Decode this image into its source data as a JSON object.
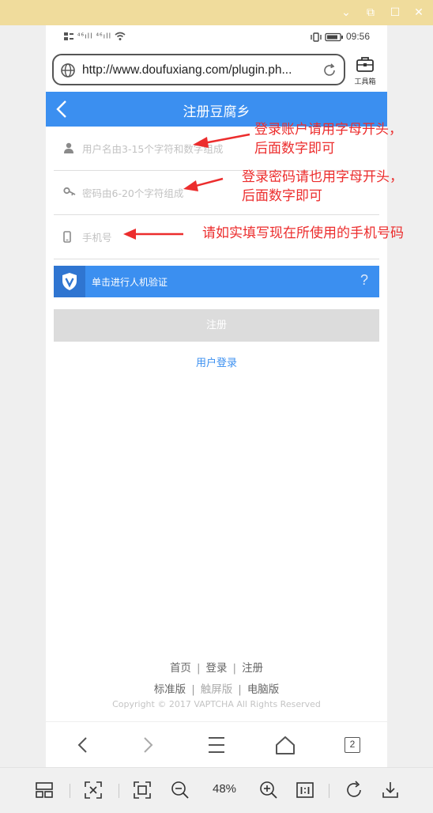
{
  "window": {
    "buttons": {
      "collapse": "⌄",
      "restore": "⧉",
      "maximize": "☐",
      "close": "✕"
    }
  },
  "status_bar": {
    "signal_text": "⁴⁶ıll ⁴⁶ıll",
    "time": "09:56"
  },
  "browser": {
    "url": "http://www.doufuxiang.com/plugin.ph...",
    "toolbox_label": "工具箱"
  },
  "page": {
    "title": "注册豆腐乡",
    "username_placeholder": "用户名由3-15个字符和数字组成",
    "password_placeholder": "密码由6-20个字符组成",
    "phone_placeholder": "手机号",
    "captcha_label": "单击进行人机验证",
    "captcha_help": "?",
    "submit_label": "注册",
    "login_link": "用户登录"
  },
  "footer": {
    "row1": [
      "首页",
      "登录",
      "注册"
    ],
    "row2": [
      "标准版",
      "触屏版",
      "电脑版"
    ],
    "separator": "|",
    "copyright": "Copyright © 2017 VAPTCHA All Rights Reserved"
  },
  "browser_nav": {
    "tab_count": "2"
  },
  "viewer_toolbar": {
    "zoom": "48%"
  },
  "annotations": {
    "username_note_line1": "登录账户请用字母开头，",
    "username_note_line2": "后面数字即可",
    "password_note_line1": "登录密码请也用字母开头，",
    "password_note_line2": "后面数字即可",
    "phone_note": "请如实填写现在所使用的手机号码"
  },
  "colors": {
    "accent": "#3b8ff0",
    "annotation": "#ec2d2d",
    "titlebar": "#f0dc9c"
  }
}
